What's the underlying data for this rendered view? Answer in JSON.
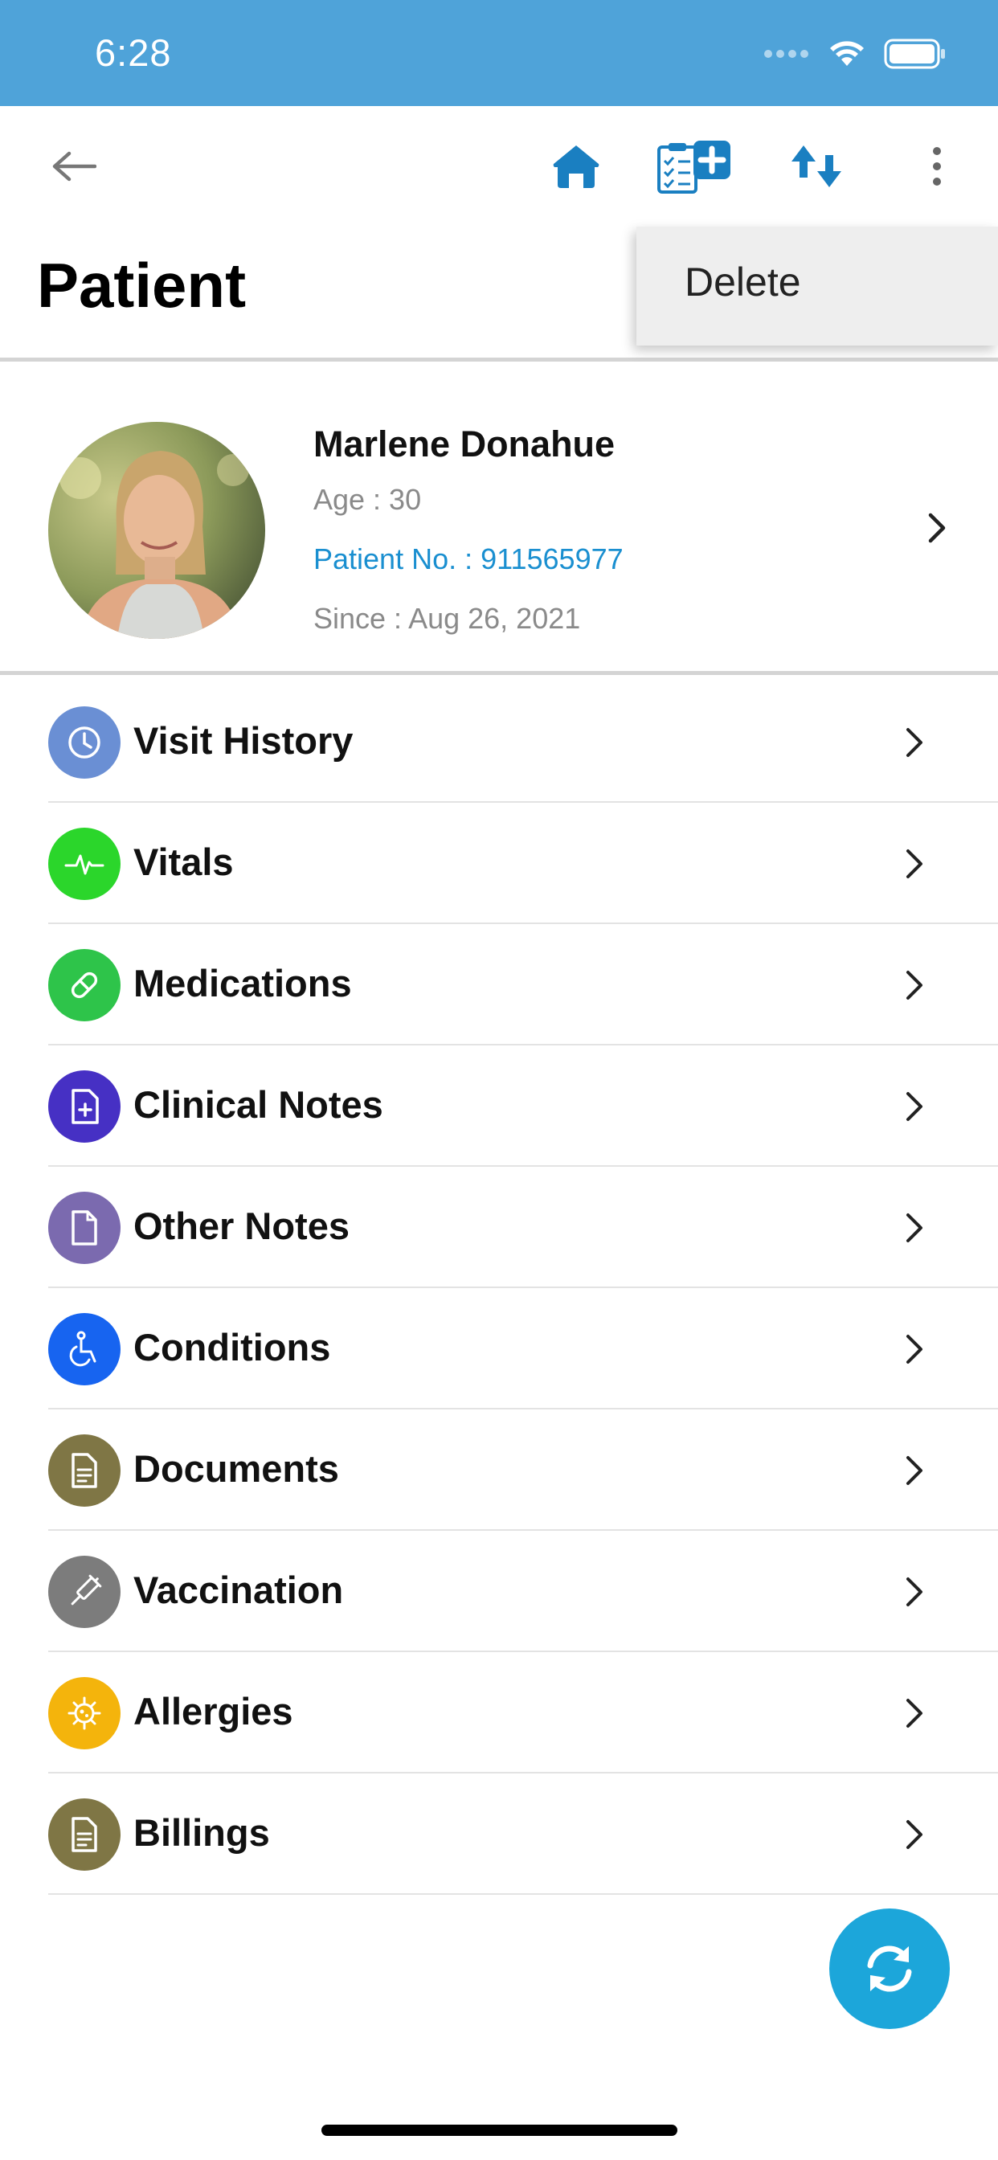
{
  "status_bar": {
    "time": "6:28",
    "background_color": "#4fa3d9"
  },
  "nav": {
    "back_icon": "arrow-left-icon",
    "home_icon": "home-icon",
    "clipboard_icon": "clipboard-medical-icon",
    "sort_icon": "sort-icon",
    "more_icon": "more-vertical-icon",
    "accent_color": "#1a7fc1"
  },
  "page": {
    "title": "Patient"
  },
  "menu": {
    "items": [
      {
        "label": "Delete"
      }
    ]
  },
  "patient": {
    "name": "Marlene Donahue",
    "age": "Age : 30",
    "patient_no": "Patient No. : 911565977",
    "since": "Since : Aug 26, 2021"
  },
  "sections": [
    {
      "label": "Visit History",
      "icon": "clock-icon",
      "color": "#6a8fd4"
    },
    {
      "label": "Vitals",
      "icon": "pulse-icon",
      "color": "#2bd62b"
    },
    {
      "label": "Medications",
      "icon": "pill-icon",
      "color": "#2ec44a"
    },
    {
      "label": "Clinical Notes",
      "icon": "medical-document-icon",
      "color": "#4630c4"
    },
    {
      "label": "Other Notes",
      "icon": "document-icon",
      "color": "#7b6aaf"
    },
    {
      "label": "Conditions",
      "icon": "wheelchair-icon",
      "color": "#1764f0"
    },
    {
      "label": "Documents",
      "icon": "file-text-icon",
      "color": "#7f7645"
    },
    {
      "label": "Vaccination",
      "icon": "syringe-icon",
      "color": "#7c7c7c"
    },
    {
      "label": "Allergies",
      "icon": "virus-icon",
      "color": "#f4b40c"
    },
    {
      "label": "Billings",
      "icon": "invoice-icon",
      "color": "#7f7645"
    }
  ],
  "fab": {
    "icon": "sync-icon",
    "color": "#1ca6da"
  }
}
